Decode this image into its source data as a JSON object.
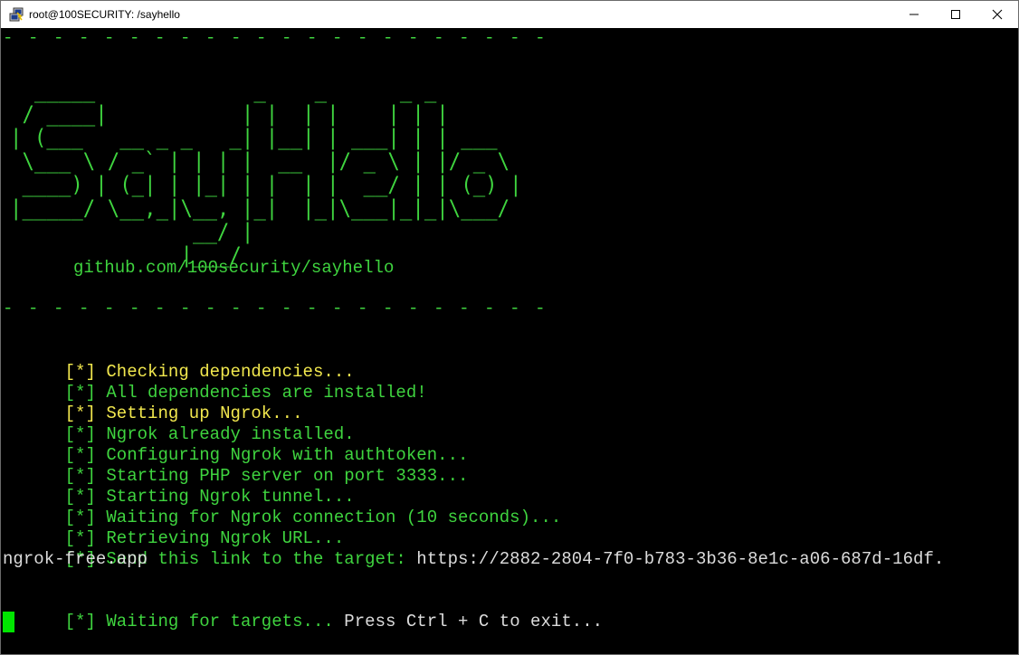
{
  "window": {
    "title": "root@100SECURITY: /sayhello"
  },
  "terminal": {
    "separator": "- - - - - - - - - - - - - - - - - - - - - -",
    "banner_art": "  _____             _    _      _ _\n / ____|           | |  | |    | | |\n| (___   __ _ _   _| |__| | ___| | | ___\n \\___ \\ / _` | | | |  __  |/ _ \\ | |/ _ \\\n ____) | (_| | |_| | |  | |  __/ | | (_) |\n|_____/ \\__,_|\\__, |_|  |_|\\___|_|_|\\___/\n               __/ |\n              |___/",
    "github_link": "github.com/100security/sayhello",
    "prefix": "[*]",
    "log": [
      {
        "text": "Checking dependencies...",
        "color": "yellow"
      },
      {
        "text": "All dependencies are installed!",
        "color": "green"
      },
      {
        "text": "Setting up Ngrok...",
        "color": "yellow"
      },
      {
        "text": "Ngrok already installed.",
        "color": "green"
      },
      {
        "text": "Configuring Ngrok with authtoken...",
        "color": "green"
      },
      {
        "text": "Starting PHP server on port 3333...",
        "color": "green"
      },
      {
        "text": "Starting Ngrok tunnel...",
        "color": "green"
      },
      {
        "text": "Waiting for Ngrok connection (10 seconds)...",
        "color": "green"
      },
      {
        "text": "Retrieving Ngrok URL...",
        "color": "green"
      }
    ],
    "send_label": "Send this link to the target:",
    "link_part1": "https://2882-2804-7f0-b783-3b36-8e1c-a06-687d-16df.",
    "link_part2": "ngrok-free.app",
    "waiting_label": "Waiting for targets...",
    "exit_hint": "Press Ctrl + C to exit...",
    "colors": {
      "green": "#3fd43f",
      "yellow": "#f2e84e",
      "white": "#dcdcdc",
      "cursor": "#00e600",
      "background": "#000000"
    }
  }
}
